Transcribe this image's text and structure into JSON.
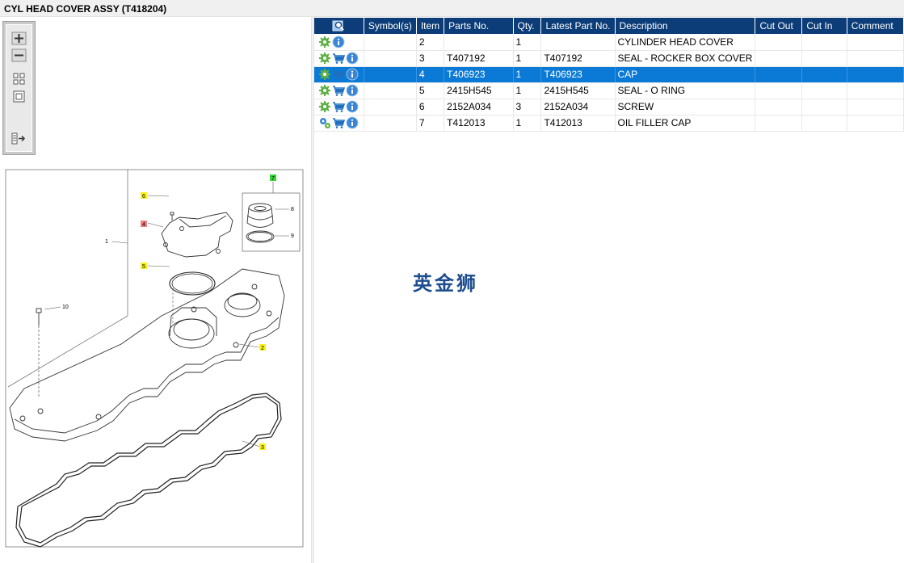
{
  "window": {
    "title": "CYL HEAD COVER ASSY (T418204)"
  },
  "toolbox": {
    "buttons": [
      "zoom-in",
      "zoom-out",
      "fit-page",
      "actual-size",
      "toggle-list"
    ]
  },
  "drawing": {
    "callouts": [
      {
        "label": "1",
        "highlight": "none"
      },
      {
        "label": "2",
        "highlight": "#f6f21a"
      },
      {
        "label": "3",
        "highlight": "#f6f21a"
      },
      {
        "label": "4",
        "highlight": "#f08080"
      },
      {
        "label": "5",
        "highlight": "#f6f21a"
      },
      {
        "label": "6",
        "highlight": "#f6f21a"
      },
      {
        "label": "7",
        "highlight": "#35d435"
      },
      {
        "label": "8",
        "highlight": "none"
      },
      {
        "label": "9",
        "highlight": "none"
      },
      {
        "label": "10",
        "highlight": "none"
      }
    ]
  },
  "table": {
    "columns": [
      "",
      "Symbol(s)",
      "Item",
      "Parts No.",
      "Qty.",
      "Latest Part No.",
      "Description",
      "Cut Out",
      "Cut In",
      "Comment"
    ],
    "rows": [
      {
        "icons": [
          "settings-icon",
          "info-icon"
        ],
        "item": "2",
        "part": "",
        "qty": "1",
        "latest": "",
        "desc": "CYLINDER HEAD COVER",
        "selected": false
      },
      {
        "icons": [
          "settings-icon",
          "cart-icon",
          "info-icon"
        ],
        "item": "3",
        "part": "T407192",
        "qty": "1",
        "latest": "T407192",
        "desc": "SEAL - ROCKER BOX COVER",
        "selected": false
      },
      {
        "icons": [
          "settings-icon",
          "cart-icon",
          "info-icon"
        ],
        "item": "4",
        "part": "T406923",
        "qty": "1",
        "latest": "T406923",
        "desc": "CAP",
        "selected": true
      },
      {
        "icons": [
          "settings-icon",
          "cart-icon",
          "info-icon"
        ],
        "item": "5",
        "part": "2415H545",
        "qty": "1",
        "latest": "2415H545",
        "desc": "SEAL - O RING",
        "selected": false
      },
      {
        "icons": [
          "settings-icon",
          "cart-icon",
          "info-icon"
        ],
        "item": "6",
        "part": "2152A034",
        "qty": "3",
        "latest": "2152A034",
        "desc": "SCREW",
        "selected": false
      },
      {
        "icons": [
          "gears-icon",
          "cart-icon",
          "info-icon"
        ],
        "item": "7",
        "part": "T412013",
        "qty": "1",
        "latest": "T412013",
        "desc": "OIL FILLER CAP",
        "selected": false
      }
    ]
  },
  "watermark": "英金狮",
  "colors": {
    "header": "#0c3d78",
    "selection": "#0a7ad6",
    "gear": "#4caf50",
    "cart": "#1e6fc0",
    "info": "#3a86d4"
  }
}
